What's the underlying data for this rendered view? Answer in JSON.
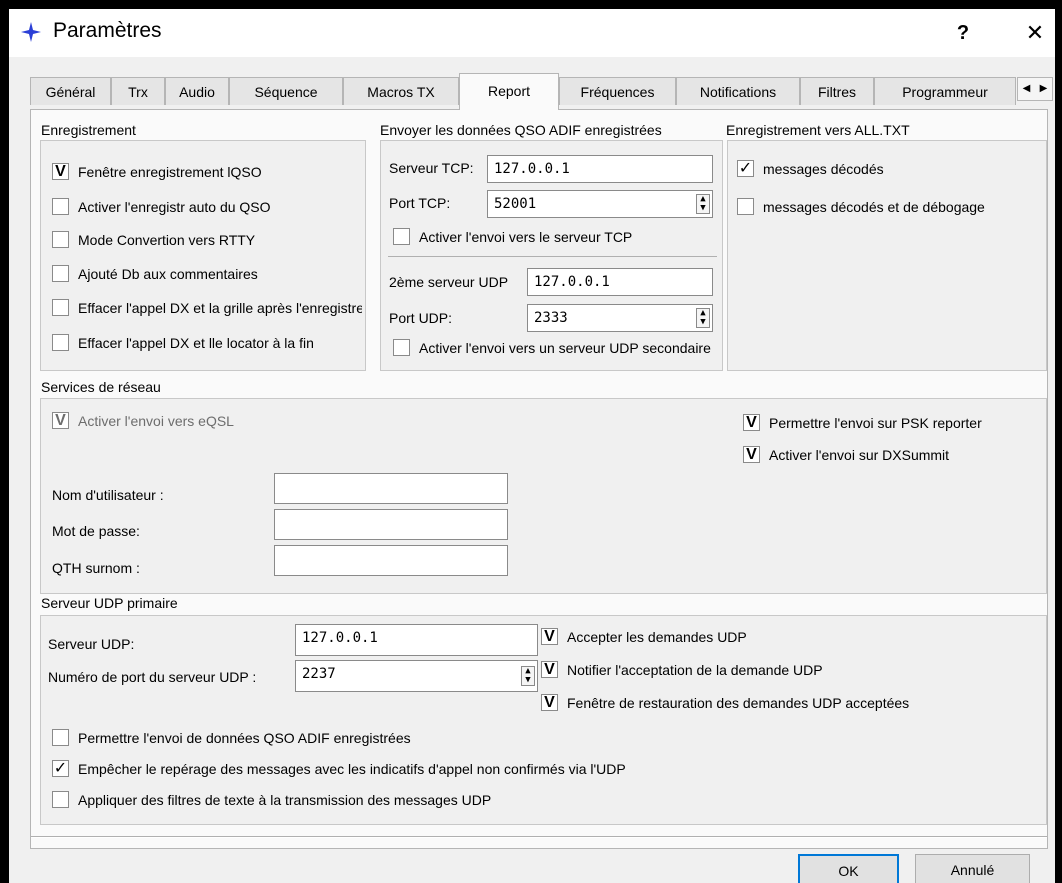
{
  "window": {
    "title": "Paramètres",
    "help": "?",
    "close": "✕"
  },
  "tabs": [
    "Général",
    "Trx",
    "Audio",
    "Séquence",
    "Macros TX",
    "Report",
    "Fréquences",
    "Notifications",
    "Filtres",
    "Programmeur"
  ],
  "tab_scroll": {
    "left": "◀",
    "right": "▶"
  },
  "logging": {
    "title": "Enregistrement",
    "items": [
      {
        "label": "Fenêtre enregistrement lQSO",
        "checked": true,
        "mark": "V"
      },
      {
        "label": "Activer l'enregistr auto du QSO",
        "checked": false,
        "mark": ""
      },
      {
        "label": "Mode Convertion vers RTTY",
        "checked": false,
        "mark": ""
      },
      {
        "label": "Ajouté Db aux commentaires",
        "checked": false,
        "mark": ""
      },
      {
        "label": "Effacer l'appel DX et la grille après l'enregistrement",
        "checked": false,
        "mark": ""
      },
      {
        "label": "Effacer l'appel DX et lle locator à la fin",
        "checked": false,
        "mark": ""
      }
    ]
  },
  "adif": {
    "title": "Envoyer les données QSO ADIF enregistrées",
    "tcp_server_label": "Serveur TCP:",
    "tcp_server_value": "127.0.0.1",
    "tcp_port_label": "Port TCP:",
    "tcp_port_value": "52001",
    "tcp_enable_label": "Activer l'envoi vers le serveur TCP",
    "udp2_server_label": "2ème serveur UDP",
    "udp2_server_value": "127.0.0.1",
    "udp2_port_label": "Port UDP:",
    "udp2_port_value": "2333",
    "udp2_enable_label": "Activer l'envoi vers un serveur UDP secondaire"
  },
  "alltxt": {
    "title": "Enregistrement vers ALL.TXT",
    "items": [
      {
        "label": "messages décodés",
        "checked": true,
        "mark": "✓"
      },
      {
        "label": "messages décodés et de débogage",
        "checked": false,
        "mark": ""
      }
    ]
  },
  "network": {
    "title": "Services de réseau",
    "eqsl_label": "Activer l'envoi vers eQSL",
    "eqsl_mark": "V",
    "psk_label": "Permettre l'envoi sur PSK reporter",
    "psk_mark": "V",
    "dxsummit_label": "Activer l'envoi sur DXSummit",
    "dxsummit_mark": "V",
    "username_label": "Nom d'utilisateur :",
    "password_label": "Mot de passe:",
    "qth_label": "QTH surnom :"
  },
  "udp_primary": {
    "title": "Serveur UDP primaire",
    "server_label": "Serveur UDP:",
    "server_value": "127.0.0.1",
    "port_label": "Numéro de port du serveur UDP :",
    "port_value": "2237",
    "accept_label": "Accepter les demandes UDP",
    "accept_mark": "V",
    "notify_label": "Notifier l'acceptation de la demande UDP",
    "notify_mark": "V",
    "restore_label": "Fenêtre de restauration des demandes UDP acceptées",
    "restore_mark": "V",
    "allow_adif_label": "Permettre l'envoi de données QSO ADIF enregistrées",
    "allow_adif_mark": "",
    "prevent_label": "Empêcher le repérage des messages avec les indicatifs d'appel non confirmés via l'UDP",
    "prevent_mark": "✓",
    "filters_label": "Appliquer des filtres de texte à la transmission des messages UDP",
    "filters_mark": ""
  },
  "buttons": {
    "ok": "OK",
    "cancel": "Annulé"
  },
  "colors": {
    "accent": "#0078d7",
    "icon": "#2b3fd6"
  }
}
